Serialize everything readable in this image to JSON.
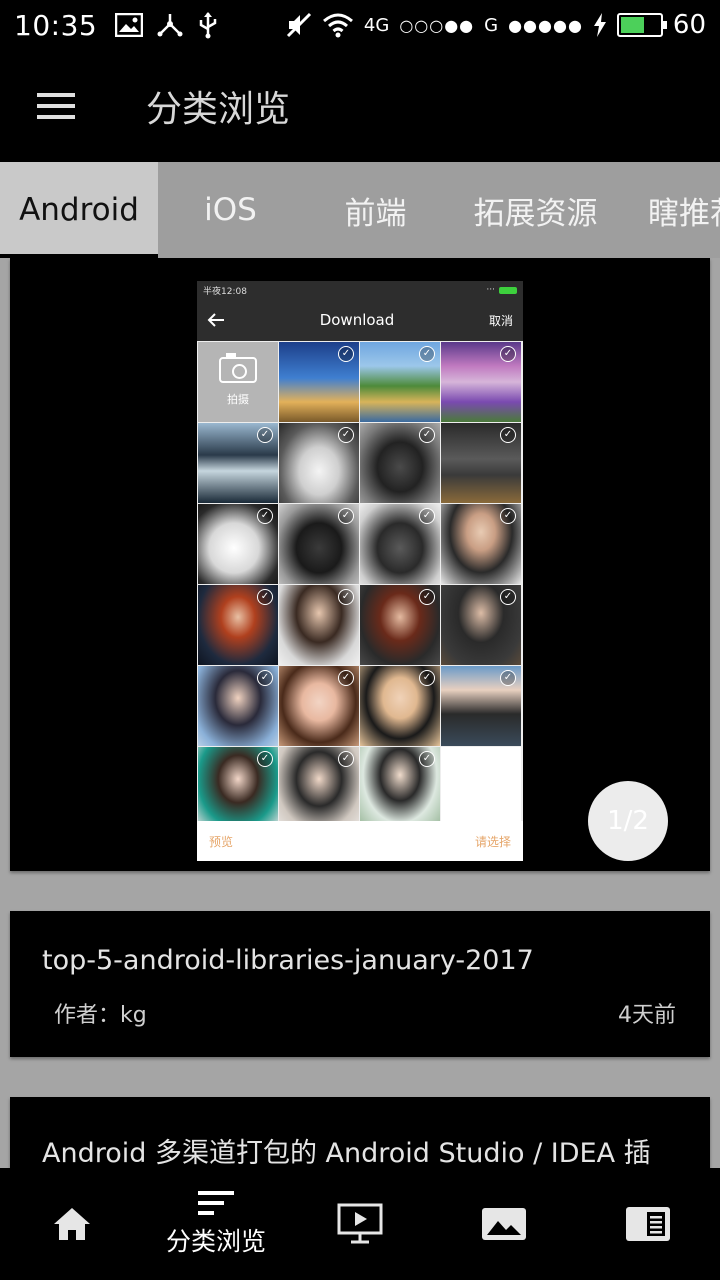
{
  "status_bar": {
    "time": "10:35",
    "net_4g": "4G",
    "signal_dots_1": "○○○●●",
    "net_g": "G",
    "signal_dots_2": "●●●●●",
    "battery_level": "60",
    "battery_color": "#4cd05a"
  },
  "app_bar": {
    "title": "分类浏览",
    "menu_icon": "hamburger-menu-icon"
  },
  "tabs": [
    {
      "label": "Android",
      "active": true
    },
    {
      "label": "iOS",
      "active": false
    },
    {
      "label": "前端",
      "active": false
    },
    {
      "label": "拓展资源",
      "active": false
    },
    {
      "label": "瞎推荐",
      "active": false
    }
  ],
  "image_card": {
    "pager_text": "1/2",
    "embedded_screenshot": {
      "status_time": "半夜12:08",
      "title": "Download",
      "cancel": "取消",
      "camera_label": "拍摄",
      "preview": "预览",
      "select": "请选择"
    }
  },
  "articles": [
    {
      "title": "top-5-android-libraries-january-2017",
      "author": "作者：kg",
      "time": "4天前"
    },
    {
      "title": "Android 多渠道打包的 Android Studio / IDEA 插"
    }
  ],
  "bottom_nav": [
    {
      "icon": "home-icon",
      "label": ""
    },
    {
      "icon": "category-list-icon",
      "label": "分类浏览"
    },
    {
      "icon": "video-icon",
      "label": ""
    },
    {
      "icon": "image-icon",
      "label": ""
    },
    {
      "icon": "reader-icon",
      "label": ""
    }
  ]
}
